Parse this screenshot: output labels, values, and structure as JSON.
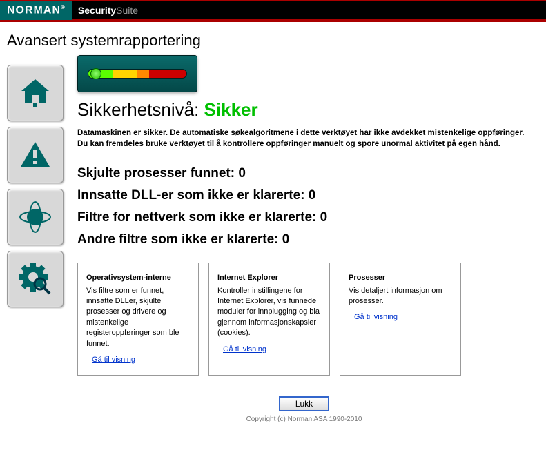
{
  "header": {
    "brand": "NORMAN",
    "product_a": "Security",
    "product_b": "Suite"
  },
  "page_title": "Avansert systemrapportering",
  "security_level": {
    "label": "Sikkerhetsnivå:",
    "status": "Sikker"
  },
  "description": "Datamaskinen er sikker. De automatiske søkealgoritmene i dette verktøyet har ikke avdekket mistenkelige oppføringer. Du kan fremdeles bruke verktøyet til å kontrollere oppføringer manuelt og spore unormal aktivitet på egen hånd.",
  "stats": [
    {
      "label": "Skjulte prosesser funnet:",
      "value": "0"
    },
    {
      "label": "Innsatte DLL-er som ikke er klarerte:",
      "value": "0"
    },
    {
      "label": "Filtre for nettverk som ikke er klarerte:",
      "value": "0"
    },
    {
      "label": "Andre filtre som ikke er klarerte:",
      "value": "0"
    }
  ],
  "cards": [
    {
      "title": "Operativsystem-interne",
      "body": "Vis filtre som er funnet, innsatte DLLer, skjulte prosesser og drivere og mistenkelige registeroppføringer som ble funnet.",
      "link": "Gå til visning"
    },
    {
      "title": "Internet Explorer",
      "body": "Kontroller instillingene for Internet Explorer, vis funnede moduler for innplugging og bla gjennom informasjonskapsler (cookies).",
      "link": "Gå til visning"
    },
    {
      "title": "Prosesser",
      "body": "Vis detaljert informasjon om prosesser.",
      "link": "Gå til visning"
    }
  ],
  "footer": {
    "close": "Lukk",
    "copyright": "Copyright (c) Norman ASA 1990-2010"
  }
}
